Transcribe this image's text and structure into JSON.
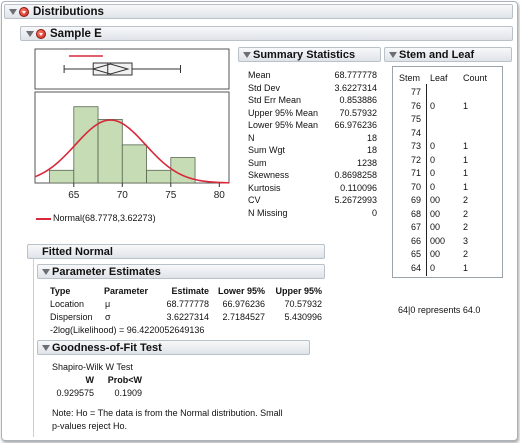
{
  "window": {
    "title": "Distributions"
  },
  "sample": {
    "title": "Sample E",
    "legend_label": "Normal(68.7778,3.62273)",
    "x_ticks": [
      "65",
      "70",
      "75",
      "80"
    ]
  },
  "chart_data": {
    "type": "bar",
    "title": "",
    "xlabel": "",
    "ylabel": "",
    "bin_edges": [
      62.5,
      65,
      67.5,
      70,
      72.5,
      75,
      77.5
    ],
    "counts": [
      1,
      6,
      5,
      3,
      1,
      2
    ],
    "xlim": [
      61,
      81
    ],
    "normal_fit": {
      "mean": 68.7778,
      "sd": 3.62273
    },
    "boxplot": {
      "min": 64,
      "q1": 67,
      "median": 68.5,
      "mean": 68.777778,
      "q3": 71,
      "max": 76,
      "shortest_half": [
        64.5,
        68
      ]
    }
  },
  "summary": {
    "title": "Summary Statistics",
    "rows": [
      {
        "label": "Mean",
        "value": "68.777778"
      },
      {
        "label": "Std Dev",
        "value": "3.6227314"
      },
      {
        "label": "Std Err Mean",
        "value": "0.853886"
      },
      {
        "label": "Upper 95% Mean",
        "value": "70.57932"
      },
      {
        "label": "Lower 95% Mean",
        "value": "66.976236"
      },
      {
        "label": "N",
        "value": "18"
      },
      {
        "label": "Sum Wgt",
        "value": "18"
      },
      {
        "label": "Sum",
        "value": "1238"
      },
      {
        "label": "Skewness",
        "value": "0.8698258"
      },
      {
        "label": "Kurtosis",
        "value": "0.110096"
      },
      {
        "label": "CV",
        "value": "5.2672993"
      },
      {
        "label": "N Missing",
        "value": "0"
      }
    ]
  },
  "stem_leaf": {
    "title": "Stem and Leaf",
    "headers": [
      "Stem",
      "Leaf",
      "Count"
    ],
    "rows": [
      {
        "stem": "77",
        "leaf": "",
        "count": ""
      },
      {
        "stem": "76",
        "leaf": "0",
        "count": "1"
      },
      {
        "stem": "75",
        "leaf": "",
        "count": ""
      },
      {
        "stem": "74",
        "leaf": "",
        "count": ""
      },
      {
        "stem": "73",
        "leaf": "0",
        "count": "1"
      },
      {
        "stem": "72",
        "leaf": "0",
        "count": "1"
      },
      {
        "stem": "71",
        "leaf": "0",
        "count": "1"
      },
      {
        "stem": "70",
        "leaf": "0",
        "count": "1"
      },
      {
        "stem": "69",
        "leaf": "00",
        "count": "2"
      },
      {
        "stem": "68",
        "leaf": "00",
        "count": "2"
      },
      {
        "stem": "67",
        "leaf": "00",
        "count": "2"
      },
      {
        "stem": "66",
        "leaf": "000",
        "count": "3"
      },
      {
        "stem": "65",
        "leaf": "00",
        "count": "2"
      },
      {
        "stem": "64",
        "leaf": "0",
        "count": "1"
      }
    ],
    "note": "64|0 represents 64.0"
  },
  "fitted": {
    "title": "Fitted Normal",
    "param_title": "Parameter Estimates",
    "headers": [
      "Type",
      "Parameter",
      "Estimate",
      "Lower 95%",
      "Upper 95%"
    ],
    "rows": [
      {
        "type": "Location",
        "param": "μ",
        "estimate": "68.777778",
        "lower": "66.976236",
        "upper": "70.57932"
      },
      {
        "type": "Dispersion",
        "param": "σ",
        "estimate": "3.6227314",
        "lower": "2.7184527",
        "upper": "5.430996"
      }
    ],
    "loglik": "-2log(Likelihood) = 96.4220052649136"
  },
  "gof": {
    "title": "Goodness-of-Fit Test",
    "test_name": "Shapiro-Wilk W Test",
    "col_w": "W",
    "col_p": "Prob<W",
    "w": "0.929575",
    "p": "0.1909",
    "note1": "Note: Ho = The data is from the Normal distribution. Small",
    "note2": "p-values reject Ho."
  },
  "colors": {
    "bar_fill": "#c5dcb4",
    "bar_stroke": "#596652",
    "curve": "#d8283a",
    "box_fill": "#f1f1f1"
  }
}
